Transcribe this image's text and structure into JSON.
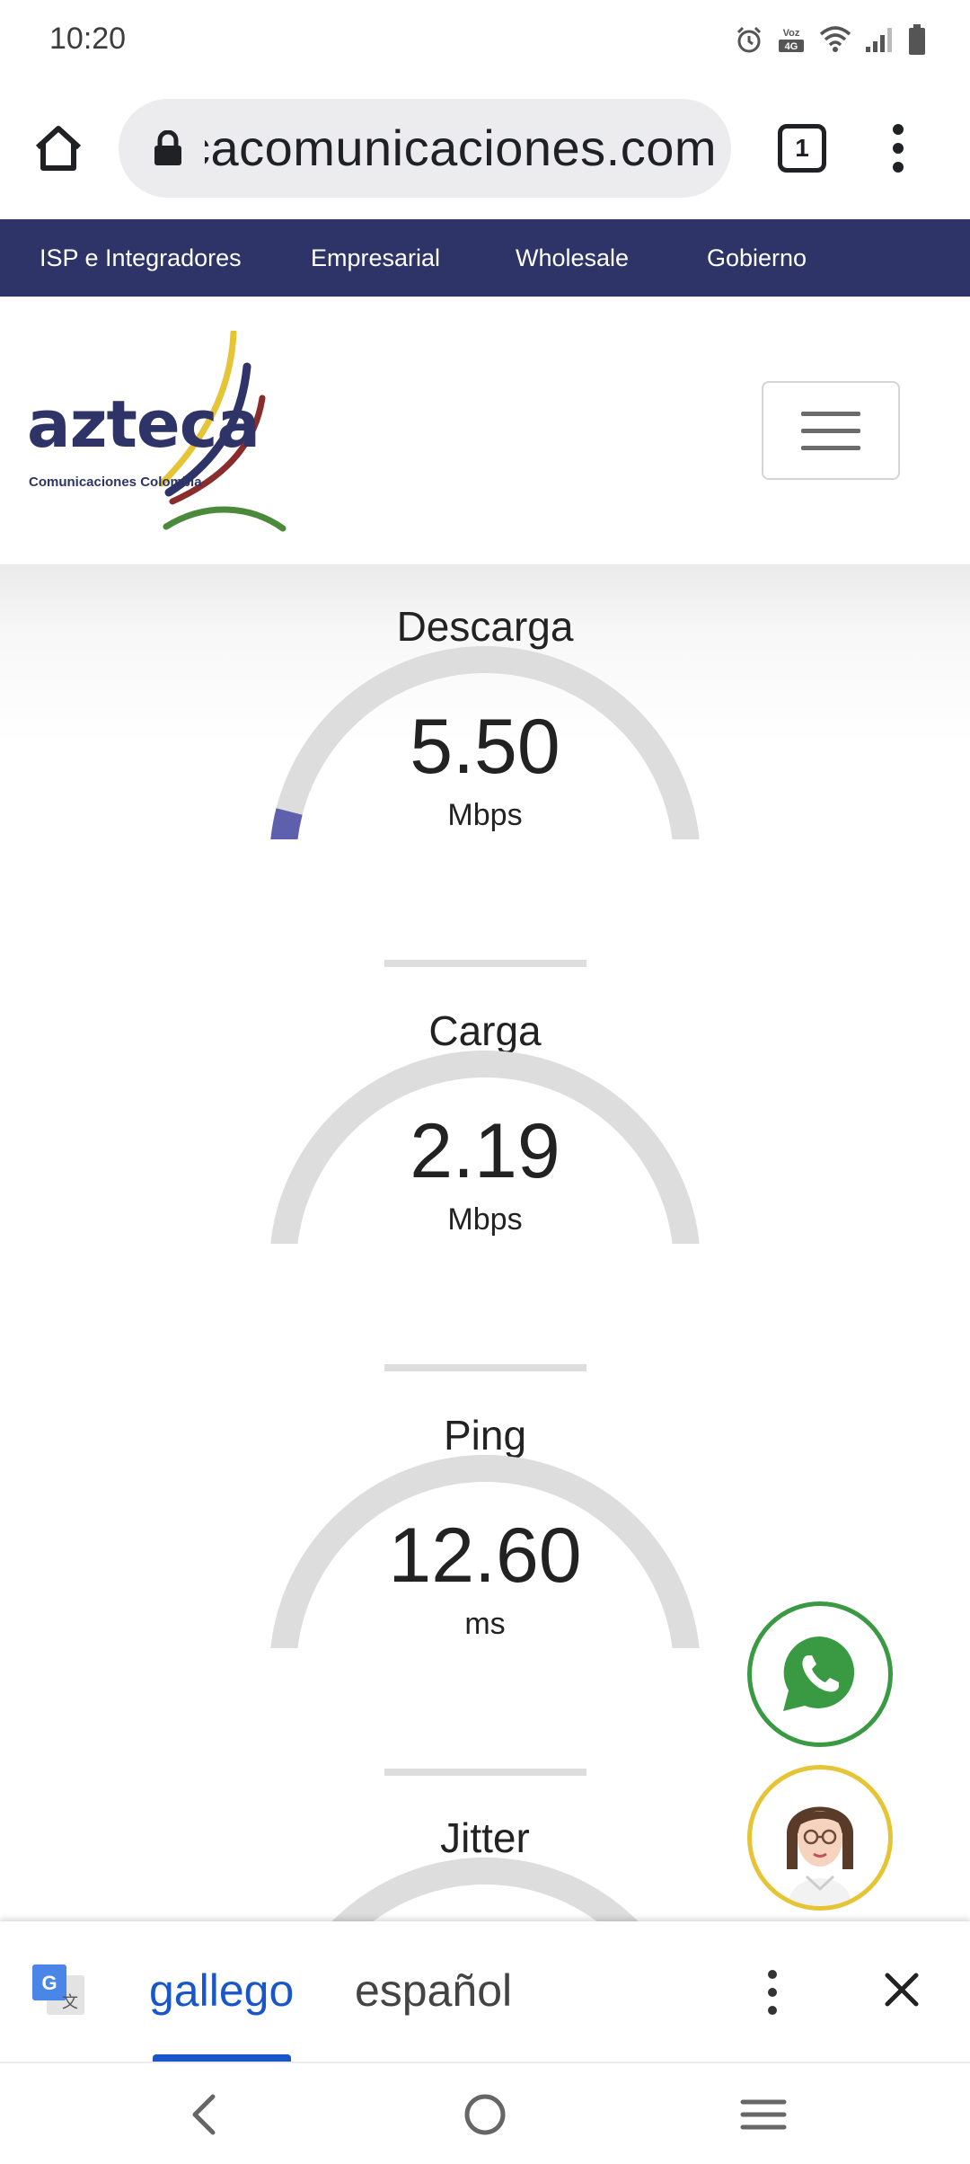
{
  "status_bar": {
    "time": "10:20",
    "network_label": "Voz 4G",
    "icons": [
      "alarm-icon",
      "volte-icon",
      "wifi-icon",
      "signal-icon",
      "battery-icon"
    ]
  },
  "browser": {
    "url": "aztecacomunicaciones.com",
    "tab_count": "1",
    "icons": [
      "home-icon",
      "lock-icon",
      "tabs-icon",
      "overflow-menu-icon"
    ]
  },
  "site_nav": {
    "items": [
      {
        "label": "ISP e Integradores"
      },
      {
        "label": "Empresarial"
      },
      {
        "label": "Wholesale"
      },
      {
        "label": "Gobierno"
      }
    ],
    "background": "#2e3467"
  },
  "header": {
    "logo_word": "azteca",
    "logo_sub": "Comunicaciones Colombia",
    "menu_icon": "hamburger-icon"
  },
  "gauges": [
    {
      "title": "Descarga",
      "value": "5.50",
      "unit": "Mbps",
      "fill_fraction": 0.22,
      "color": "#5e60ae"
    },
    {
      "title": "Carga",
      "value": "2.19",
      "unit": "Mbps",
      "fill_fraction": 0.12,
      "color": "#2f9235"
    },
    {
      "title": "Ping",
      "value": "12.60",
      "unit": "ms",
      "fill_fraction": 0.07,
      "color": "#ad5c5f"
    },
    {
      "title": "Jitter",
      "value": "",
      "unit": "",
      "fill_fraction": 0,
      "color": "#dddddd"
    }
  ],
  "floating": {
    "whatsapp_icon": "whatsapp-icon",
    "agent_icon": "support-agent-avatar",
    "whatsapp_color": "#3a9a43",
    "agent_color": "#e5c436"
  },
  "translate_bar": {
    "source_lang": "gallego",
    "target_lang": "español",
    "icons": [
      "google-translate-icon",
      "more-options-icon",
      "close-icon"
    ]
  },
  "system_nav": {
    "icons": [
      "back-icon",
      "home-circle-icon",
      "recents-icon"
    ]
  }
}
